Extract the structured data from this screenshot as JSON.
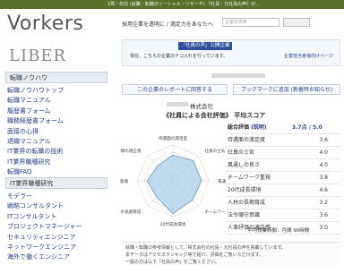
{
  "topbar": {
    "text": "1周・年収 (就職・転職のソーシャル・リサーチ) 《社員・元社員の声》が…"
  },
  "left": {
    "logo_main": "Vorkers",
    "logo_sub": "LIBER",
    "section1_title": "転職ノウハウ",
    "section1_items": [
      "転職ノウハウトップ",
      "転職マニュアル",
      "履歴書フォーム",
      "職務経歴書フォーム",
      "面接の心得",
      "退職マニュアル",
      "IT業界の転職の技術",
      "IT業界職種研究",
      "転職FAQ"
    ],
    "section2_title": "IT業界職種研究",
    "section2_items": [
      "モデラー",
      "戦略コンサルタント",
      "ITコンサルタント",
      "プロジェクトマネージャー",
      "セキュリティエンジニア",
      "ネットワークエンジニア",
      "海外で働くエンジニア"
    ]
  },
  "search": {
    "label": "採用企業を透明に / 満足力をあなたへ",
    "placeholder": "企業名検索"
  },
  "panel": {
    "badge": "「社員の声」公開企業",
    "text": "現在、こちらの企業のテコ入れを行っています。",
    "link": "企業担当者様向けページ"
  },
  "buttons": {
    "report": "この企業のレポートに回答する",
    "bookmark": "ブックマークに追加 (新着時お知らせ)"
  },
  "company": {
    "title": "株式会社",
    "score_title": "《社員による会社評価》 平均スコア"
  },
  "table": {
    "header_label": "総合評価",
    "header_sub": "(説明)",
    "header_score": "3.7点 / 5.0",
    "rows": [
      {
        "label": "待遇面の満足度",
        "value": "3.6"
      },
      {
        "label": "社員の士気",
        "value": "4.0"
      },
      {
        "label": "風通しの良さ",
        "value": "4.0"
      },
      {
        "label": "チームワーク重視",
        "value": "3.8"
      },
      {
        "label": "20代成長環境",
        "value": "4.6"
      },
      {
        "label": "人材の長期育成",
        "value": "3.2"
      },
      {
        "label": "法令順守意識",
        "value": "3.6"
      },
      {
        "label": "人事評価の適正感",
        "value": "3.0"
      }
    ],
    "avg_text": "平均残業時間：月間 90時間"
  },
  "radar": {
    "axes": [
      "待遇面の満足度",
      "社員の士気",
      "風通しの良さ",
      "チームワーク重視",
      "20代成長環境",
      "人材の長期育成",
      "法令順守意識",
      "人事評価の適正感"
    ],
    "values": [
      3.6,
      4.0,
      4.0,
      3.8,
      4.6,
      3.2,
      3.6,
      3.0
    ],
    "max": 5
  },
  "notes": {
    "line1": "就職・転職の参考情報として、株式会社の社員・元社員の声を掲載しています。",
    "line2": "本データはアクセスランキング等で紹介、評価をご覧いただけます。",
    "line3": "一般の方は以下「社員の声」をご覧ください。"
  },
  "colors": {
    "topbar": "#5a6f2a",
    "accent": "#2d4f9a",
    "radar_fill": "#a9cfe6"
  }
}
